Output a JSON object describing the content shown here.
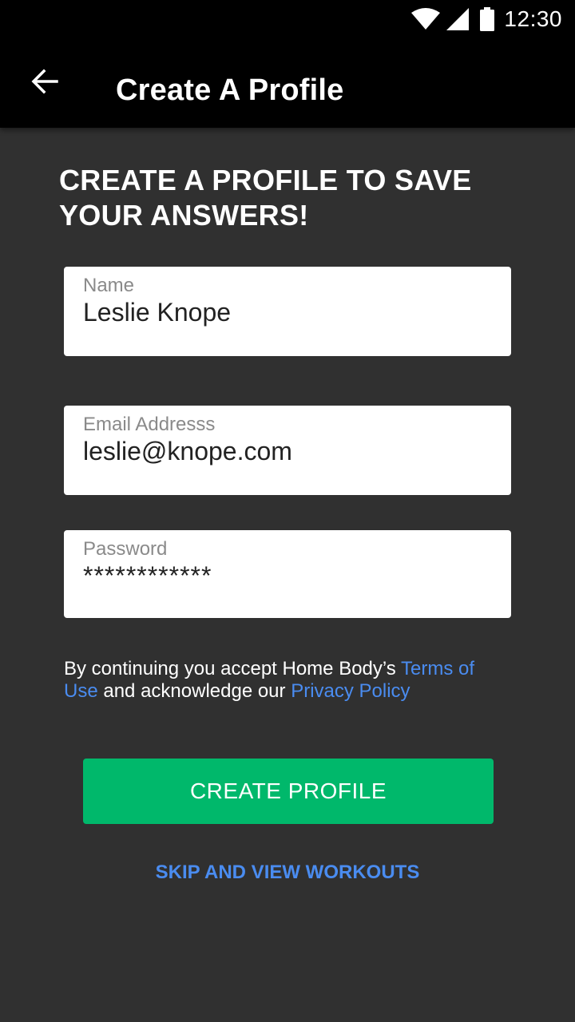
{
  "status_bar": {
    "time": "12:30",
    "icons": [
      "wifi-icon",
      "cell-signal-icon",
      "battery-icon"
    ]
  },
  "app_bar": {
    "back_icon": "arrow-left-icon",
    "title": "Create A Profile"
  },
  "headline": "CREATE A PROFILE TO SAVE YOUR ANSWERS!",
  "form": {
    "name": {
      "label": "Name",
      "value": "Leslie Knope"
    },
    "email": {
      "label": "Email Addresss",
      "value": "leslie@knope.com"
    },
    "password": {
      "label": "Password",
      "value": "************"
    }
  },
  "consent": {
    "prefix": "By continuing you accept Home Body’s ",
    "terms_link": "Terms of Use",
    "middle": " and acknowledge our ",
    "privacy_link": "Privacy Policy"
  },
  "actions": {
    "create_label": "CREATE PROFILE",
    "skip_label": "SKIP AND VIEW WORKOUTS"
  },
  "colors": {
    "background": "#303030",
    "bar": "#000000",
    "accent_green": "#00b86b",
    "link_blue": "#4a8cf0"
  }
}
